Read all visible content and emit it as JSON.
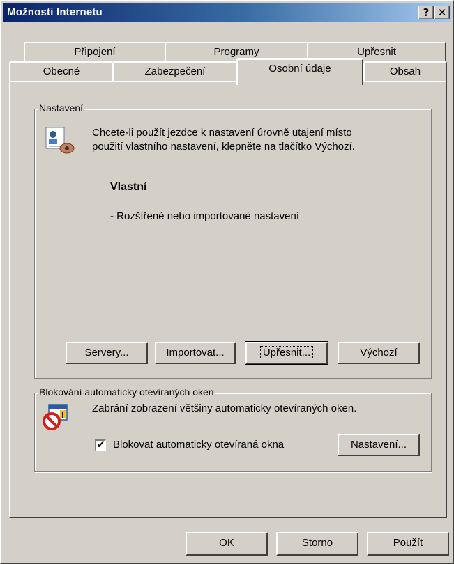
{
  "window": {
    "title": "Možnosti Internetu",
    "help_button": "?",
    "close_button": "✕"
  },
  "tabs_row1": [
    "Připojení",
    "Programy",
    "Upřesnit"
  ],
  "tabs_row2": [
    "Obecné",
    "Zabezpečení",
    "Osobní údaje",
    "Obsah"
  ],
  "active_tab": "Osobní údaje",
  "settings_group": {
    "label": "Nastavení",
    "description_line1": "Chcete-li použít jezdce k nastavení úrovně utajení místo",
    "description_line2": "použití vlastního nastavení, klepněte na tlačítko Výchozí.",
    "level_title": "Vlastní",
    "level_desc": "- Rozšířené nebo importované nastavení",
    "buttons": {
      "servers": "Servery...",
      "import": "Importovat...",
      "advanced": "Upřesnit...",
      "default": "Výchozí"
    }
  },
  "popup_group": {
    "label": "Blokování automaticky otevíraných oken",
    "description": "Zabrání zobrazení většiny automaticky otevíraných oken.",
    "checkbox_label": "Blokovat automaticky otevíraná okna",
    "checkbox_checked": true,
    "settings_button": "Nastavení..."
  },
  "footer": {
    "ok": "OK",
    "cancel": "Storno",
    "apply": "Použít"
  },
  "icons": {
    "privacy": "privacy-person-icon",
    "popup_blocker": "popup-blocker-icon"
  }
}
